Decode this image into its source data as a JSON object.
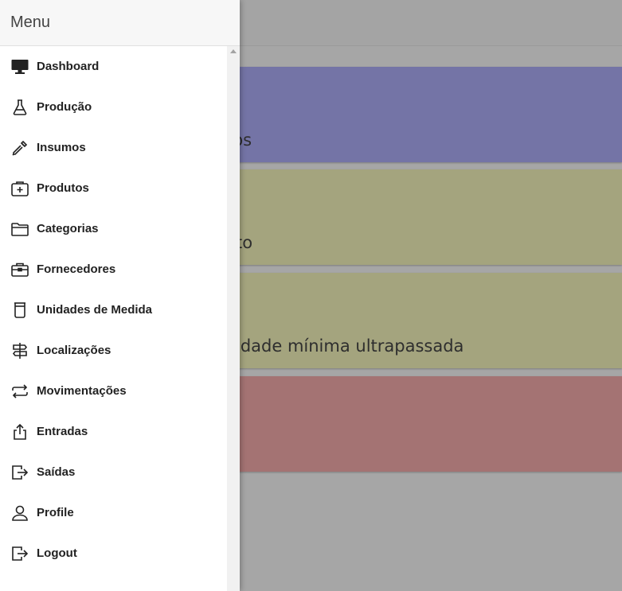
{
  "background": {
    "cards": [
      {
        "text": "dos",
        "color": "#7474a6"
      },
      {
        "text": "to",
        "color": "#a4a47e"
      },
      {
        "text": "idade mínima ultrapassada",
        "color": "#a4a47e"
      },
      {
        "text": "",
        "color": "#a47373"
      }
    ]
  },
  "drawer": {
    "title": "Menu",
    "items": [
      {
        "label": "Dashboard",
        "icon": "monitor-icon"
      },
      {
        "label": "Produção",
        "icon": "flask-icon"
      },
      {
        "label": "Insumos",
        "icon": "dropper-icon"
      },
      {
        "label": "Produtos",
        "icon": "box-plus-icon"
      },
      {
        "label": "Categorias",
        "icon": "folder-icon"
      },
      {
        "label": "Fornecedores",
        "icon": "briefcase-icon"
      },
      {
        "label": "Unidades de Medida",
        "icon": "cylinder-icon"
      },
      {
        "label": "Localizações",
        "icon": "signpost-icon"
      },
      {
        "label": "Movimentações",
        "icon": "arrows-repeat-icon"
      },
      {
        "label": "Entradas",
        "icon": "upload-icon"
      },
      {
        "label": "Saídas",
        "icon": "exit-icon"
      },
      {
        "label": "Profile",
        "icon": "person-icon"
      },
      {
        "label": "Logout",
        "icon": "logout-icon"
      }
    ]
  }
}
